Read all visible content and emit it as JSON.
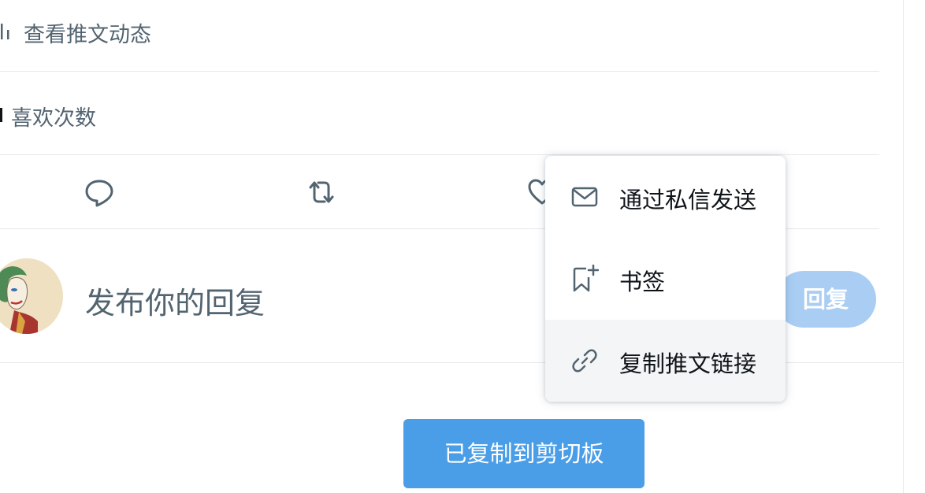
{
  "stats": {
    "activity_label": "查看推文动态",
    "likes_label": "喜欢次数"
  },
  "actions": {
    "icons": [
      "reply-icon",
      "retweet-icon",
      "like-icon"
    ]
  },
  "composer": {
    "placeholder": "发布你的回复",
    "reply_button": "回复"
  },
  "menu": {
    "items": [
      {
        "label": "通过私信发送",
        "icon": "mail-icon"
      },
      {
        "label": "书签",
        "icon": "bookmark-add-icon"
      },
      {
        "label": "复制推文链接",
        "icon": "link-icon",
        "highlighted": true
      }
    ]
  },
  "toast": {
    "message": "已复制到剪切板"
  },
  "colors": {
    "accent": "#4a9de7",
    "reply_button_disabled": "#a9cdf3",
    "secondary_text": "#536471"
  }
}
